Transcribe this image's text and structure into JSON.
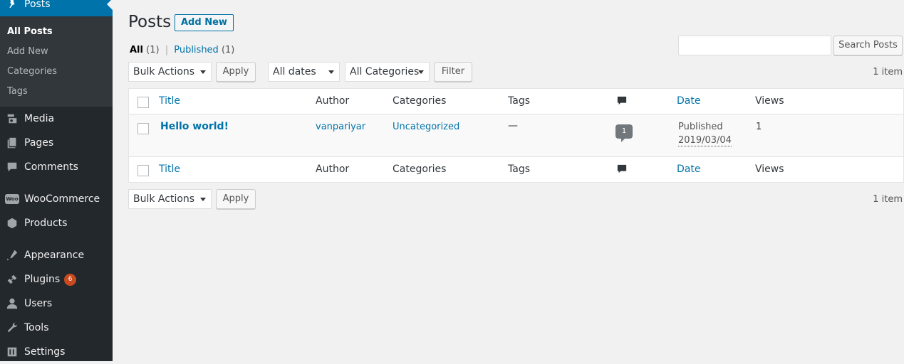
{
  "sidebar": {
    "menu": [
      {
        "label": "Posts",
        "icon": "pushpin-icon",
        "current": true
      },
      {
        "label": "Media",
        "icon": "media-icon"
      },
      {
        "label": "Pages",
        "icon": "pages-icon"
      },
      {
        "label": "Comments",
        "icon": "comments-icon"
      },
      {
        "label": "WooCommerce",
        "icon": "woocommerce-icon"
      },
      {
        "label": "Products",
        "icon": "products-icon"
      },
      {
        "label": "Appearance",
        "icon": "appearance-icon"
      },
      {
        "label": "Plugins",
        "icon": "plugins-icon",
        "badge": "6"
      },
      {
        "label": "Users",
        "icon": "users-icon"
      },
      {
        "label": "Tools",
        "icon": "tools-icon"
      },
      {
        "label": "Settings",
        "icon": "settings-icon"
      }
    ],
    "submenu": [
      "All Posts",
      "Add New",
      "Categories",
      "Tags"
    ],
    "woo_icon_text": "Woo"
  },
  "page": {
    "title": "Posts",
    "add_new": "Add New"
  },
  "views": {
    "all_label": "All",
    "all_count": "(1)",
    "separator": "|",
    "published_label": "Published",
    "published_count": "(1)"
  },
  "search": {
    "value": "",
    "button": "Search Posts"
  },
  "filters": {
    "bulk_actions": "Bulk Actions",
    "apply": "Apply",
    "dates": "All dates",
    "categories": "All Categories",
    "filter": "Filter",
    "items_count": "1 item"
  },
  "table": {
    "columns": {
      "title": "Title",
      "author": "Author",
      "categories": "Categories",
      "tags": "Tags",
      "date": "Date",
      "views": "Views"
    },
    "rows": [
      {
        "title": "Hello world!",
        "author": "vanpariyar",
        "categories": "Uncategorized",
        "tags": "—",
        "comments": "1",
        "date_status": "Published",
        "date": "2019/03/04",
        "views": "1"
      }
    ]
  },
  "colors": {
    "sidebar_bg": "#23282d",
    "submenu_bg": "#32373c",
    "current_bg": "#0073aa",
    "link": "#0073aa",
    "badge": "#ca4a1f"
  }
}
